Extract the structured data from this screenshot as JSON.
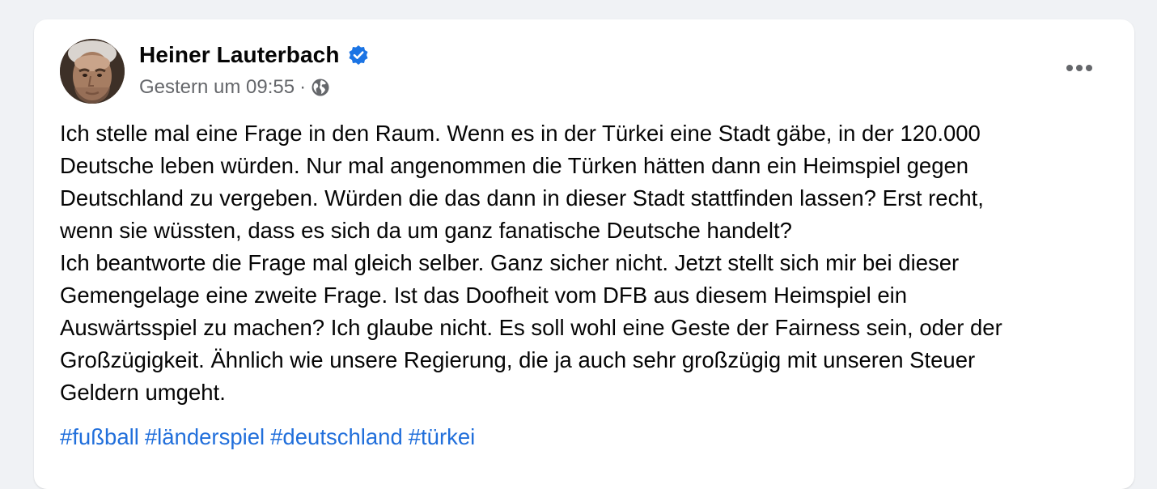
{
  "post": {
    "author": "Heiner Lauterbach",
    "timestamp": "Gestern um 09:55",
    "separator": "·",
    "audience_icon": "globe-icon",
    "verified_icon": "verified-badge-icon",
    "more_icon": "more-options-icon",
    "lines": [
      "Ich stelle mal eine Frage in den Raum. Wenn es in der Türkei eine Stadt gäbe, in der 120.000",
      "Deutsche leben würden. Nur mal angenommen die Türken hätten dann ein Heimspiel gegen",
      "Deutschland zu vergeben. Würden die das dann in dieser Stadt stattfinden lassen? Erst recht,",
      "wenn sie wüssten, dass es sich da um ganz fanatische Deutsche handelt?",
      "Ich beantworte die Frage mal gleich selber. Ganz sicher nicht. Jetzt stellt sich mir bei dieser",
      "Gemengelage eine zweite Frage. Ist das Doofheit vom DFB aus diesem Heimspiel ein",
      "Auswärtsspiel zu machen? Ich glaube nicht. Es soll wohl eine Geste der Fairness sein, oder der",
      "Großzügigkeit. Ähnlich wie unsere Regierung, die ja auch sehr großzügig mit unseren Steuer",
      "Geldern umgeht."
    ],
    "hashtags": [
      "#fußball",
      "#länderspiel",
      "#deutschland",
      "#türkei"
    ]
  },
  "colors": {
    "background": "#f0f2f5",
    "card": "#ffffff",
    "text": "#050505",
    "secondary_text": "#65676b",
    "link": "#216fdb",
    "verified": "#1b74e4"
  }
}
